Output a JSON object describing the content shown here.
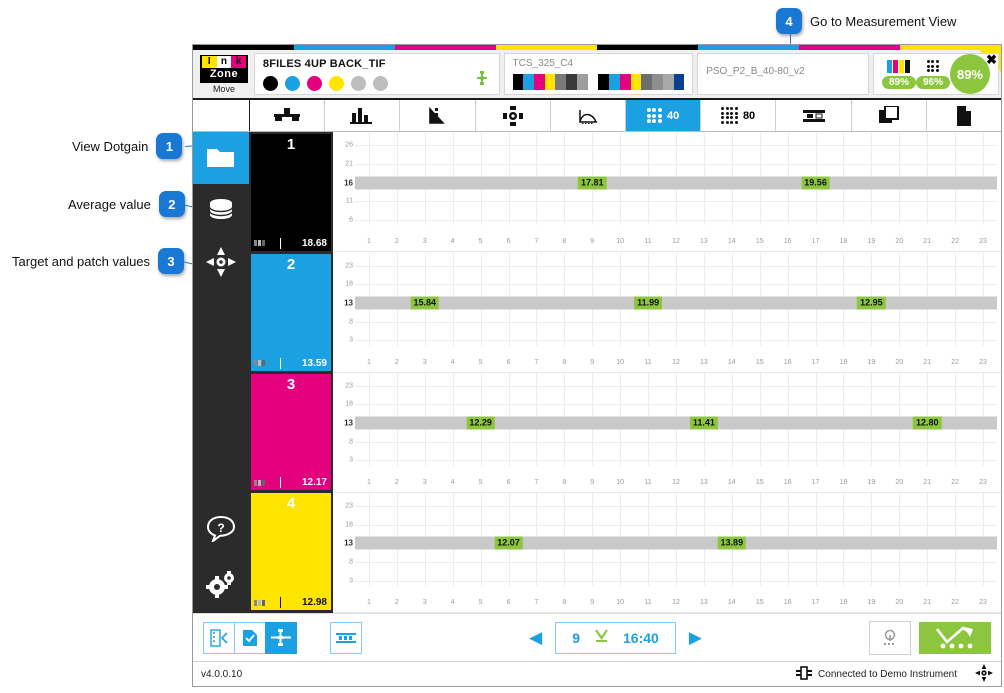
{
  "annotations": [
    {
      "num": "1",
      "label": "View Dotgain"
    },
    {
      "num": "2",
      "label": "Average value"
    },
    {
      "num": "3",
      "label": "Target and patch values"
    },
    {
      "num": "4",
      "label": "Go to Measurement View"
    }
  ],
  "window": {
    "close_label": "✖",
    "top_strip_colors": [
      "#000000",
      "#1ba1e2",
      "#e5007d",
      "#ffe400",
      "#000000",
      "#1ba1e2",
      "#e5007d",
      "#ffe400"
    ]
  },
  "header": {
    "logo": {
      "letters": [
        "I",
        "n",
        "k"
      ],
      "word": "Zone",
      "sub": "Move"
    },
    "job": {
      "title": "8FILES 4UP BACK_TIF",
      "ink_dots": [
        "#000000",
        "#1ba1e2",
        "#e5007d",
        "#ffe400",
        "#bdbdbd",
        "#bdbdbd"
      ],
      "register_icon": "register-mark-icon"
    },
    "strip": {
      "name": "TCS_325_C4",
      "swatches": [
        "#000000",
        "#1ba1e2",
        "#e5007d",
        "#ffe400",
        "#7a7a7a",
        "#3a3a3a",
        "#9e9e9e",
        "#ffffff",
        "#000000",
        "#1ba1e2",
        "#e5007d",
        "#ffe400",
        "#6e6e6e",
        "#8e8e8e",
        "#a8a8a8",
        "#0b3f8f"
      ]
    },
    "profile": {
      "name": "PSO_P2_B_40-80_v2"
    },
    "kpis": [
      {
        "icon": "color-bars-icon",
        "value": "89%"
      },
      {
        "icon": "dot-matrix-icon",
        "value": "96%"
      }
    ],
    "overall": {
      "value": "89%"
    }
  },
  "tabs": [
    {
      "name": "tab-inkkey",
      "icon": "ink-key-icon",
      "label": "",
      "active": false
    },
    {
      "name": "tab-bars",
      "icon": "bar-chart-icon",
      "label": "",
      "active": false
    },
    {
      "name": "tab-density",
      "icon": "density-wedge-icon",
      "label": "",
      "active": false
    },
    {
      "name": "tab-register",
      "icon": "register-icon",
      "label": "",
      "active": false
    },
    {
      "name": "tab-curve",
      "icon": "curve-icon",
      "label": "",
      "active": false
    },
    {
      "name": "tab-dotgain40",
      "icon": "dot-matrix-icon",
      "label": "40",
      "active": true
    },
    {
      "name": "tab-dotgain80",
      "icon": "dot-matrix-icon",
      "label": "80",
      "active": false
    },
    {
      "name": "tab-balance",
      "icon": "gray-balance-icon",
      "label": "",
      "active": false
    },
    {
      "name": "tab-overlay",
      "icon": "overlay-icon",
      "label": "",
      "active": false
    },
    {
      "name": "tab-report",
      "icon": "document-icon",
      "label": "",
      "active": false
    }
  ],
  "nav": [
    {
      "name": "nav-job",
      "icon": "folder-icon",
      "selected": true
    },
    {
      "name": "nav-database",
      "icon": "database-icon",
      "selected": false
    },
    {
      "name": "nav-calibrate",
      "icon": "target-icon",
      "selected": false
    },
    {
      "name": "nav-help",
      "icon": "help-bubble-icon",
      "selected": false
    },
    {
      "name": "nav-settings",
      "icon": "gears-icon",
      "selected": false
    }
  ],
  "channels": [
    {
      "num": "1",
      "color": "#000000",
      "text_color": "#ffffff",
      "average": "18.68",
      "label_icon": "dotgain-icon"
    },
    {
      "num": "2",
      "color": "#1ba1e2",
      "text_color": "#ffffff",
      "average": "13.59",
      "label_icon": "dotgain-icon"
    },
    {
      "num": "3",
      "color": "#e5007d",
      "text_color": "#ffffff",
      "average": "12.17",
      "label_icon": "dotgain-icon"
    },
    {
      "num": "4",
      "color": "#ffe400",
      "text_color": "#111111",
      "average": "12.98",
      "label_icon": "dotgain-icon"
    }
  ],
  "chart_data": [
    {
      "type": "bar",
      "title": "Dotgain 40% - Black",
      "xlabel": "",
      "ylabel": "",
      "ylim": [
        3.5,
        28.5
      ],
      "yticks": [
        26,
        21,
        16,
        11,
        6
      ],
      "target": 16,
      "categories": [
        1,
        2,
        3,
        4,
        5,
        6,
        7,
        8,
        9,
        10,
        11,
        12,
        13,
        14,
        15,
        16,
        17,
        18,
        19,
        20,
        21,
        22,
        23
      ],
      "xlim": [
        1,
        23
      ],
      "grid": true,
      "points": [
        {
          "x": 9,
          "value": "17.81"
        },
        {
          "x": 17,
          "value": "19.56"
        }
      ]
    },
    {
      "type": "bar",
      "title": "Dotgain 40% - Cyan",
      "xlabel": "",
      "ylabel": "",
      "ylim": [
        0.5,
        25.5
      ],
      "yticks": [
        23,
        18,
        13,
        8,
        3
      ],
      "target": 13,
      "categories": [
        1,
        2,
        3,
        4,
        5,
        6,
        7,
        8,
        9,
        10,
        11,
        12,
        13,
        14,
        15,
        16,
        17,
        18,
        19,
        20,
        21,
        22,
        23
      ],
      "xlim": [
        1,
        23
      ],
      "grid": true,
      "points": [
        {
          "x": 3,
          "value": "15.84"
        },
        {
          "x": 11,
          "value": "11.99"
        },
        {
          "x": 19,
          "value": "12.95"
        }
      ]
    },
    {
      "type": "bar",
      "title": "Dotgain 40% - Magenta",
      "xlabel": "",
      "ylabel": "",
      "ylim": [
        0.5,
        25.5
      ],
      "yticks": [
        23,
        18,
        13,
        8,
        3
      ],
      "target": 13,
      "categories": [
        1,
        2,
        3,
        4,
        5,
        6,
        7,
        8,
        9,
        10,
        11,
        12,
        13,
        14,
        15,
        16,
        17,
        18,
        19,
        20,
        21,
        22,
        23
      ],
      "xlim": [
        1,
        23
      ],
      "grid": true,
      "points": [
        {
          "x": 5,
          "value": "12.29"
        },
        {
          "x": 13,
          "value": "11.41"
        },
        {
          "x": 21,
          "value": "12.80"
        }
      ]
    },
    {
      "type": "bar",
      "title": "Dotgain 40% - Yellow",
      "xlabel": "",
      "ylabel": "",
      "ylim": [
        0.5,
        25.5
      ],
      "yticks": [
        23,
        18,
        13,
        8,
        3
      ],
      "target": 13,
      "categories": [
        1,
        2,
        3,
        4,
        5,
        6,
        7,
        8,
        9,
        10,
        11,
        12,
        13,
        14,
        15,
        16,
        17,
        18,
        19,
        20,
        21,
        22,
        23
      ],
      "xlim": [
        1,
        23
      ],
      "grid": true,
      "points": [
        {
          "x": 6,
          "value": "12.07"
        },
        {
          "x": 14,
          "value": "13.89"
        }
      ]
    }
  ],
  "toolbar": {
    "buttons": [
      {
        "name": "strip-select-button",
        "icon": "strip-arrow-icon",
        "active": false
      },
      {
        "name": "sheet-check-button",
        "icon": "document-check-icon",
        "active": false
      },
      {
        "name": "register-button",
        "icon": "register-mark-icon",
        "active": true
      },
      {
        "name": "zones-button",
        "icon": "zones-icon",
        "active": false
      }
    ],
    "prev_label": "◀",
    "next_label": "▶",
    "sheet_number": "9",
    "sheet_time": "16:40",
    "download_icon": "download-arrow-icon",
    "lamp_icon": "lamp-icon",
    "measure_icon": "measure-arrow-icon"
  },
  "status": {
    "version": "v4.0.0.10",
    "connection": "Connected to Demo Instrument",
    "connection_icon": "instrument-icon",
    "target_icon": "target-icon"
  }
}
